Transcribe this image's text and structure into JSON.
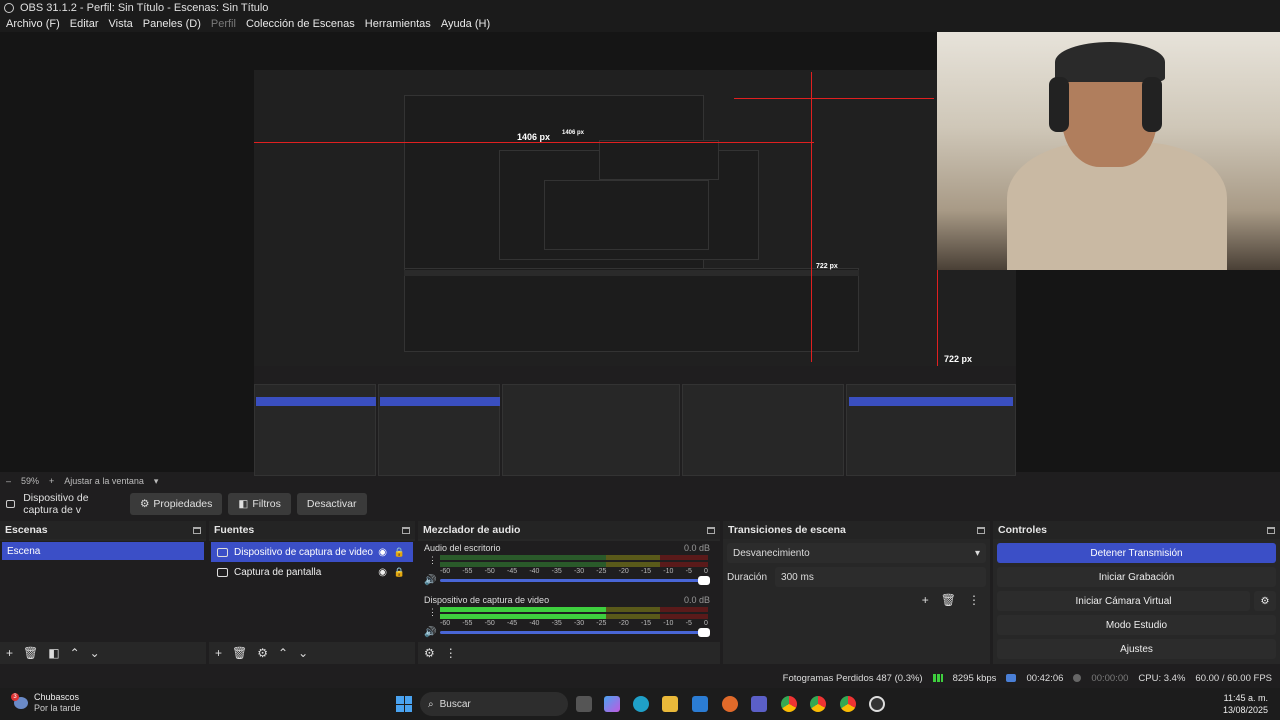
{
  "window": {
    "title": "OBS 31.1.2 - Perfil: Sin Título - Escenas: Sin Título"
  },
  "menu": [
    "Archivo (F)",
    "Editar",
    "Vista",
    "Paneles (D)",
    "Perfil",
    "Colección de Escenas",
    "Herramientas",
    "Ayuda (H)"
  ],
  "preview": {
    "width_label": "1406 px",
    "height_label": "722 px",
    "width_label_small": "1406 px",
    "height_label_small": "722 px"
  },
  "zoom": {
    "minus": "–",
    "value": "59%",
    "plus": "+",
    "fit": "Ajustar a la ventana"
  },
  "source_toolbar": {
    "source_name": "Dispositivo de captura de v",
    "properties": "Propiedades",
    "filters": "Filtros",
    "deactivate": "Desactivar"
  },
  "scenes": {
    "title": "Escenas",
    "items": [
      "Escena"
    ]
  },
  "sources": {
    "title": "Fuentes",
    "items": [
      "Dispositivo de captura de video",
      "Captura de pantalla"
    ]
  },
  "mixer": {
    "title": "Mezclador de audio",
    "tracks": [
      {
        "name": "Audio del escritorio",
        "db": "0.0 dB",
        "level": 0
      },
      {
        "name": "Dispositivo de captura de video",
        "db": "0.0 dB",
        "level": 0.62
      }
    ],
    "scale": [
      "-60",
      "-55",
      "-50",
      "-45",
      "-40",
      "-35",
      "-30",
      "-25",
      "-20",
      "-15",
      "-10",
      "-5",
      "0"
    ]
  },
  "transitions": {
    "title": "Transiciones de escena",
    "selected": "Desvanecimiento",
    "duration_label": "Duración",
    "duration_value": "300 ms"
  },
  "controls": {
    "title": "Controles",
    "buttons": [
      "Detener Transmisión",
      "Iniciar Grabación",
      "Iniciar Cámara Virtual",
      "Modo Estudio",
      "Ajustes"
    ]
  },
  "status": {
    "dropped": "Fotogramas Perdidos 487 (0.3%)",
    "bitrate": "8295 kbps",
    "live_time": "00:42:06",
    "rec_time": "00:00:00",
    "cpu": "CPU: 3.4%",
    "fps": "60.00 / 60.00 FPS"
  },
  "taskbar": {
    "weather_title": "Chubascos",
    "weather_sub": "Por la tarde",
    "weather_badge": "3",
    "search": "Buscar",
    "time": "11:45 a. m.",
    "date": "13/08/2025"
  },
  "colors": {
    "accent": "#3b4fc7",
    "red_guide": "#e02020",
    "meter_green": "#3ecf3e"
  }
}
